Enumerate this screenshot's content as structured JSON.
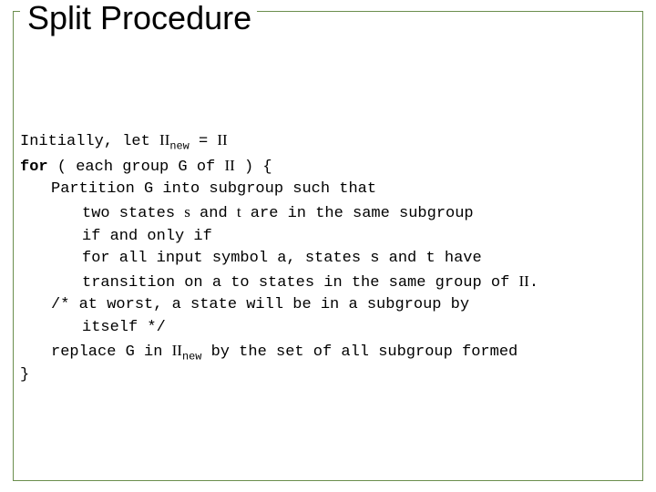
{
  "title": "Split Procedure",
  "code": {
    "l1a": "Initially, let ",
    "l1b": "II",
    "l1c": "new",
    "l1d": " = ",
    "l1e": "II",
    "l2a": "for",
    "l2b": " ( each group G of ",
    "l2c": "II",
    "l2d": " ) {",
    "l3": "Partition G into subgroup such that",
    "l4a": "two states ",
    "l4b": "s",
    "l4c": " and ",
    "l4d": "t",
    "l4e": " are in the same subgroup",
    "l5": "if and only if",
    "l6": "for all input symbol a, states s and t have",
    "l7a": "transition on a to states in the same group of ",
    "l7b": "II",
    "l7c": ".",
    "l8": "/* at worst, a state will be in a subgroup by",
    "l9": "itself */",
    "l10a": "replace G in ",
    "l10b": "II",
    "l10c": "new",
    "l10d": " by the set of all subgroup formed",
    "l11": "}"
  }
}
